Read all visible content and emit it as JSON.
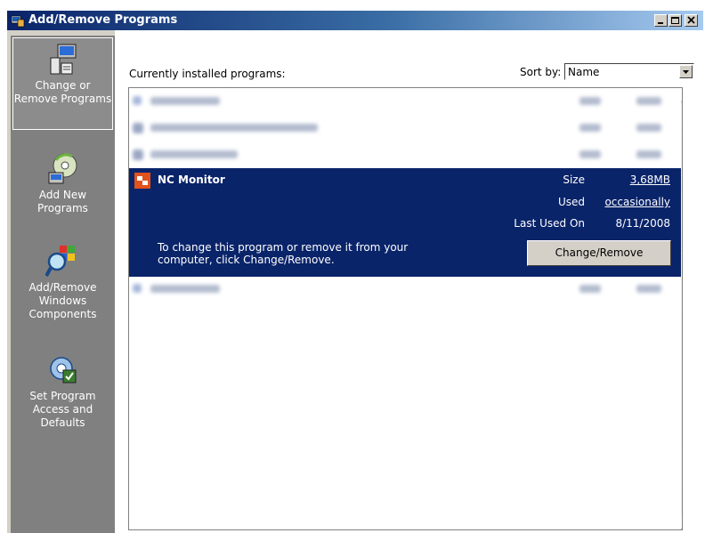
{
  "window": {
    "title": "Add/Remove Programs"
  },
  "sidebar": {
    "items": [
      {
        "label": "Change or Remove Programs",
        "icon": "change-remove-programs-icon",
        "active": true
      },
      {
        "label": "Add New Programs",
        "icon": "cd-install-icon"
      },
      {
        "label": "Add/Remove Windows Components",
        "icon": "windows-components-icon"
      },
      {
        "label": "Set Program Access and Defaults",
        "icon": "program-defaults-icon"
      }
    ]
  },
  "main": {
    "installed_label": "Currently installed programs:",
    "sort_label": "Sort by:",
    "sort_value": "Name"
  },
  "selected_program": {
    "name": "NC Monitor",
    "size_label": "Size",
    "size_value": "3,68MB",
    "used_label": "Used",
    "used_value": "occasionally",
    "last_used_label": "Last Used On",
    "last_used_value": "8/11/2008",
    "hint": "To change this program or remove it from your computer, click Change/Remove.",
    "button_label": "Change/Remove"
  },
  "colors": {
    "selection": "#0a246a",
    "sidebar": "#808080",
    "chrome": "#d4d0c8"
  }
}
